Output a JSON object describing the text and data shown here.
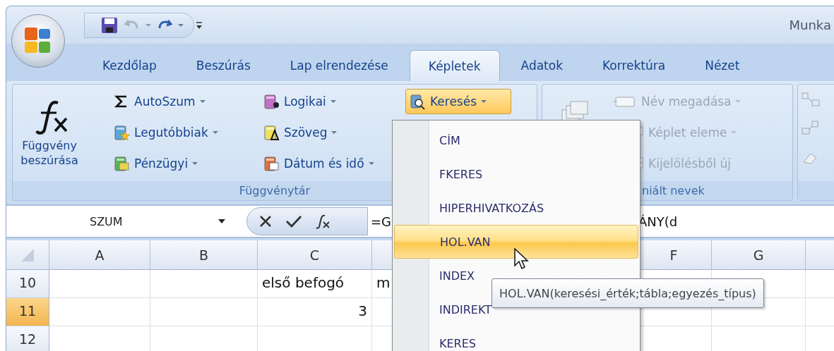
{
  "title_bar": {
    "title": "Munka"
  },
  "quick_access": [
    {
      "kind": "save",
      "disabled": false
    },
    {
      "kind": "undo",
      "disabled": true
    },
    {
      "kind": "redo",
      "disabled": false
    }
  ],
  "tabs": [
    {
      "label": "Kezdőlap",
      "selected": false
    },
    {
      "label": "Beszúrás",
      "selected": false
    },
    {
      "label": "Lap elrendezése",
      "selected": false
    },
    {
      "label": "Képletek",
      "selected": true
    },
    {
      "label": "Adatok",
      "selected": false
    },
    {
      "label": "Korrektúra",
      "selected": false
    },
    {
      "label": "Nézet",
      "selected": false
    }
  ],
  "function_library": {
    "insert_function": "Függvény beszúrása",
    "columns": [
      [
        {
          "label": "AutoSzum"
        },
        {
          "label": "Legutóbbiak"
        },
        {
          "label": "Pénzügyi"
        }
      ],
      [
        {
          "label": "Logikai"
        },
        {
          "label": "Szöveg"
        },
        {
          "label": "Dátum és idő"
        }
      ]
    ],
    "lookup": {
      "label": "Keresés",
      "pressed": true
    },
    "label": "Függvénytár"
  },
  "defined_names": {
    "disabled": true,
    "items": [
      {
        "kind": "define",
        "label": "Név megadása"
      },
      {
        "kind": "formula",
        "label": "Képlet eleme"
      },
      {
        "kind": "selection",
        "label": "Kijelölésből új"
      }
    ],
    "label": "niált nevek"
  },
  "formula_bar": {
    "name_box": "SZUM",
    "formula_left": "=G",
    "formula_right": "ÁNY(d"
  },
  "grid": {
    "columns": [
      {
        "label": "A"
      },
      {
        "label": "B"
      },
      {
        "label": "C"
      },
      {
        "label": "F"
      },
      {
        "label": "G"
      }
    ],
    "rows": [
      {
        "header": "10",
        "selected": false,
        "column_3": {
          "kind": "text",
          "text": "első befogó"
        },
        "column_4": {
          "text": "m"
        }
      },
      {
        "header": "11",
        "selected": true,
        "column_3": {
          "kind": "number",
          "text": "3"
        }
      },
      {
        "header": "12",
        "selected": false
      }
    ]
  },
  "lookup_menu": {
    "items": [
      {
        "label": "CÍM",
        "selected": false
      },
      {
        "label": "FKERES",
        "selected": false
      },
      {
        "label": "HIPERHIVATKOZÁS",
        "selected": false
      },
      {
        "label": "HOL.VAN",
        "selected": true
      },
      {
        "label": "INDEX",
        "selected": false
      },
      {
        "label": "INDIREKT",
        "selected": false
      },
      {
        "label": "KERES",
        "selected": false
      }
    ]
  },
  "tooltip": {
    "text": "HOL.VAN(keresési_érték;tábla;egyezés_típus)"
  }
}
